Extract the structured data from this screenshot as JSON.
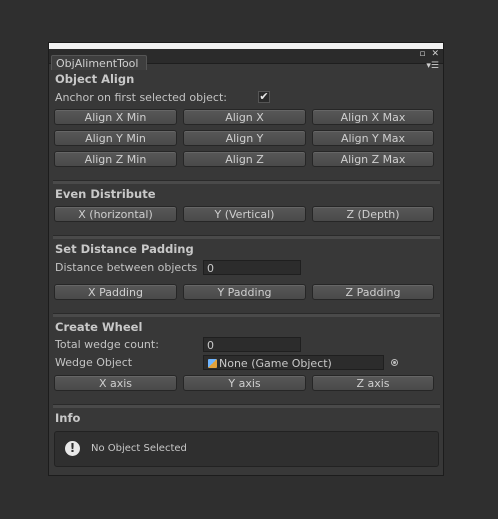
{
  "window": {
    "tab_title": "ObjAlimentTool",
    "pin_icon": "pin-icon",
    "close_icon": "close-icon",
    "menu_icon": "menu-icon"
  },
  "object_align": {
    "title": "Object Align",
    "anchor_label": "Anchor on first selected object:",
    "anchor_checked": true,
    "buttons": {
      "x_min": "Align X Min",
      "x": "Align X",
      "x_max": "Align X Max",
      "y_min": "Align Y Min",
      "y": "Align Y",
      "y_max": "Align Y Max",
      "z_min": "Align Z Min",
      "z": "Align Z",
      "z_max": "Align Z Max"
    }
  },
  "even_distribute": {
    "title": "Even Distribute",
    "x": "X (horizontal)",
    "y": "Y (Vertical)",
    "z": "Z (Depth)"
  },
  "distance_padding": {
    "title": "Set Distance Padding",
    "distance_label": "Distance between objects",
    "distance_value": "0",
    "x": "X Padding",
    "y": "Y Padding",
    "z": "Z Padding"
  },
  "create_wheel": {
    "title": "Create Wheel",
    "wedge_count_label": "Total wedge count:",
    "wedge_count_value": "0",
    "wedge_object_label": "Wedge Object",
    "wedge_object_value": "None (Game Object)",
    "x": "X axis",
    "y": "Y axis",
    "z": "Z axis"
  },
  "info": {
    "title": "Info",
    "icon": "exclamation-icon",
    "message": "No Object Selected"
  }
}
